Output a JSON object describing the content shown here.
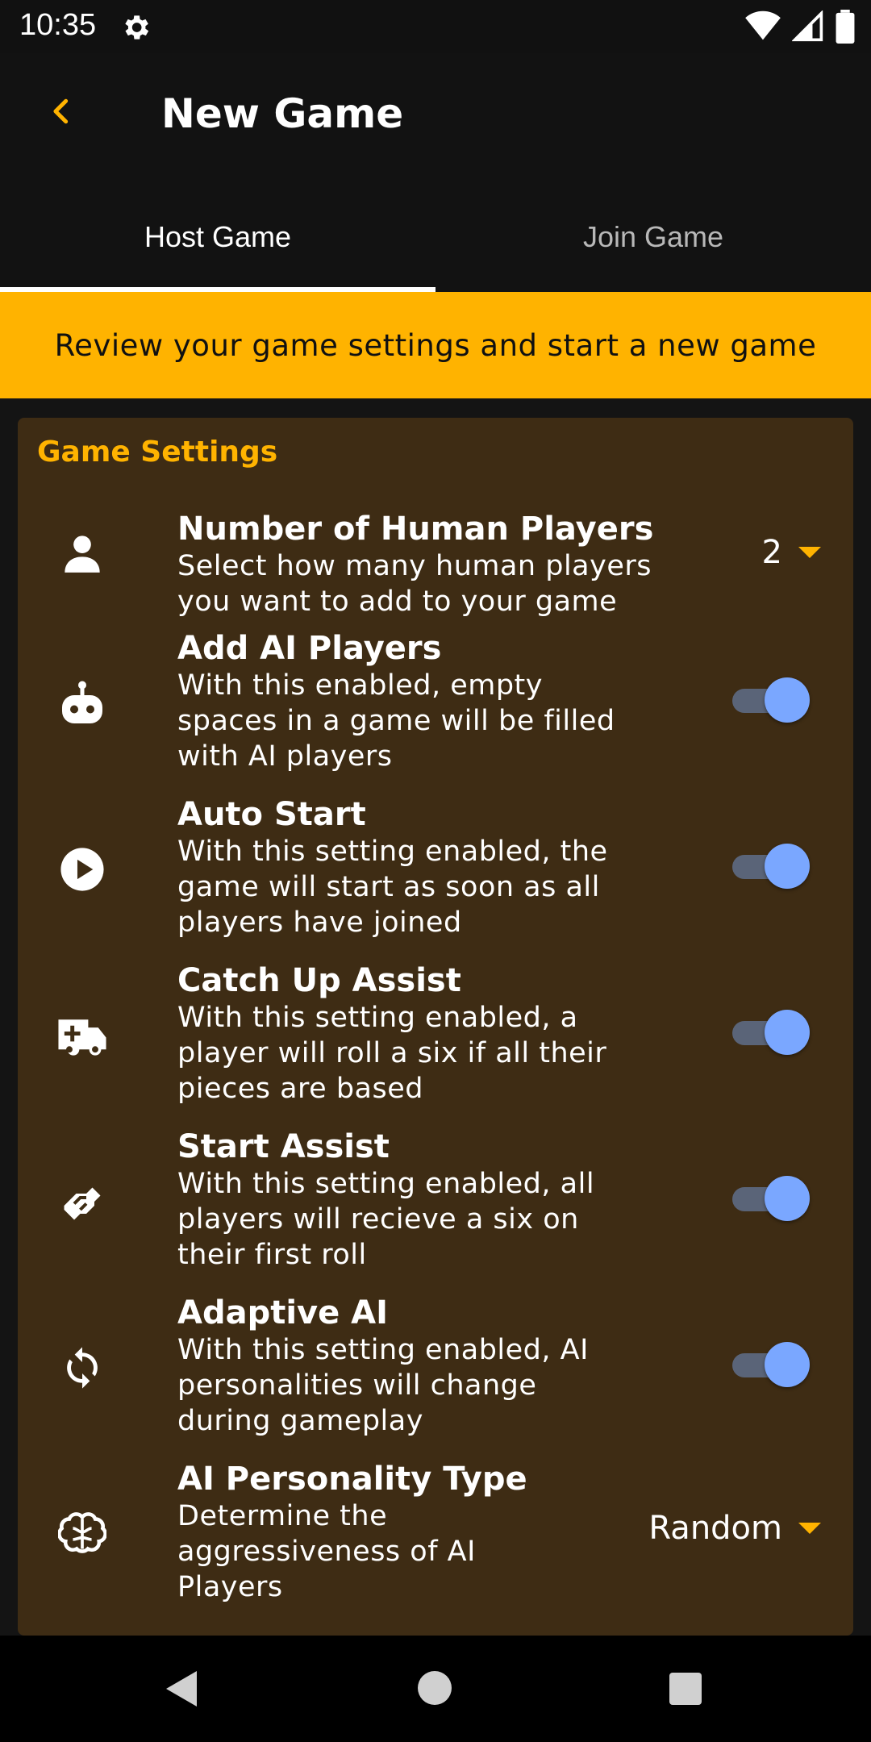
{
  "status_bar": {
    "time": "10:35"
  },
  "app_bar": {
    "title": "New Game"
  },
  "tabs": [
    {
      "label": "Host Game",
      "active": true
    },
    {
      "label": "Join Game",
      "active": false
    }
  ],
  "banner": {
    "text": "Review your game settings and start a new game"
  },
  "settings_card": {
    "title": "Game Settings",
    "rows": [
      {
        "icon": "person-icon",
        "title": "Number of Human Players",
        "desc_lines": [
          "Select how many human players",
          "you want to add to your game"
        ],
        "control": "dropdown",
        "value": "2"
      },
      {
        "icon": "robot-icon",
        "title": "Add AI Players",
        "desc_lines": [
          "With this enabled, empty",
          "spaces in a game will be filled",
          "with AI players"
        ],
        "control": "toggle",
        "on": true
      },
      {
        "icon": "play-circle-icon",
        "title": "Auto Start",
        "desc_lines": [
          "With this setting enabled, the",
          "game will start as soon as all",
          "players have joined"
        ],
        "control": "toggle",
        "on": true
      },
      {
        "icon": "ambulance-icon",
        "title": "Catch Up Assist",
        "desc_lines": [
          "With this setting enabled, a",
          "player will roll a six if all their",
          "pieces are based"
        ],
        "control": "toggle",
        "on": true
      },
      {
        "icon": "handshake-icon",
        "title": "Start Assist",
        "desc_lines": [
          "With this setting enabled, all",
          "players will recieve a six on",
          "their first roll"
        ],
        "control": "toggle",
        "on": true
      },
      {
        "icon": "sync-icon",
        "title": "Adaptive AI",
        "desc_lines": [
          "With this setting enabled, AI",
          "personalities will change",
          "during gameplay"
        ],
        "control": "toggle",
        "on": true
      },
      {
        "icon": "brain-icon",
        "title": "AI Personality Type",
        "desc_lines": [
          "Determine the",
          "aggressiveness of AI",
          "Players"
        ],
        "control": "dropdown",
        "value": "Random"
      }
    ]
  },
  "colors": {
    "accent": "#ffb300",
    "card_bg": "#3e2c14",
    "toggle_thumb": "#7aa7ff",
    "toggle_track": "#5a6478"
  }
}
